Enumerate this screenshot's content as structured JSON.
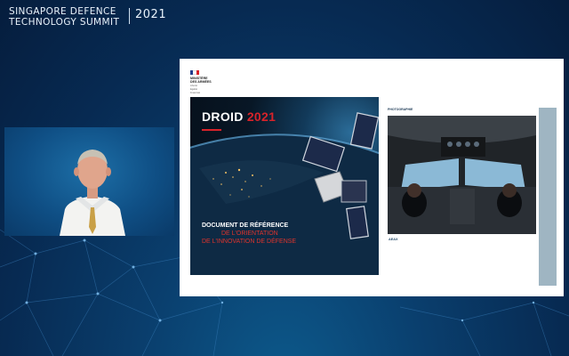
{
  "event": {
    "line1": "Singapore Defence",
    "line2": "Technology Summit",
    "year": "2021"
  },
  "speaker_video": {},
  "slide": {
    "ministry": {
      "line1": "Ministère",
      "line2": "des Armées",
      "motto1": "Liberté",
      "motto2": "Égalité",
      "motto3": "Fraternité"
    },
    "cover": {
      "title": "DROID",
      "year": "2021",
      "subtitle": [
        {
          "text": "Document de référence",
          "color": "white"
        },
        {
          "text": "de l'orientation",
          "color": "red"
        },
        {
          "text": "de l'innovation de défense",
          "color": "red"
        }
      ]
    },
    "right_page": {
      "section": "Photographie",
      "caption_title": "AEAX",
      "colors": {
        "teal": "#9fb5c2",
        "red": "#d8232a"
      }
    }
  }
}
